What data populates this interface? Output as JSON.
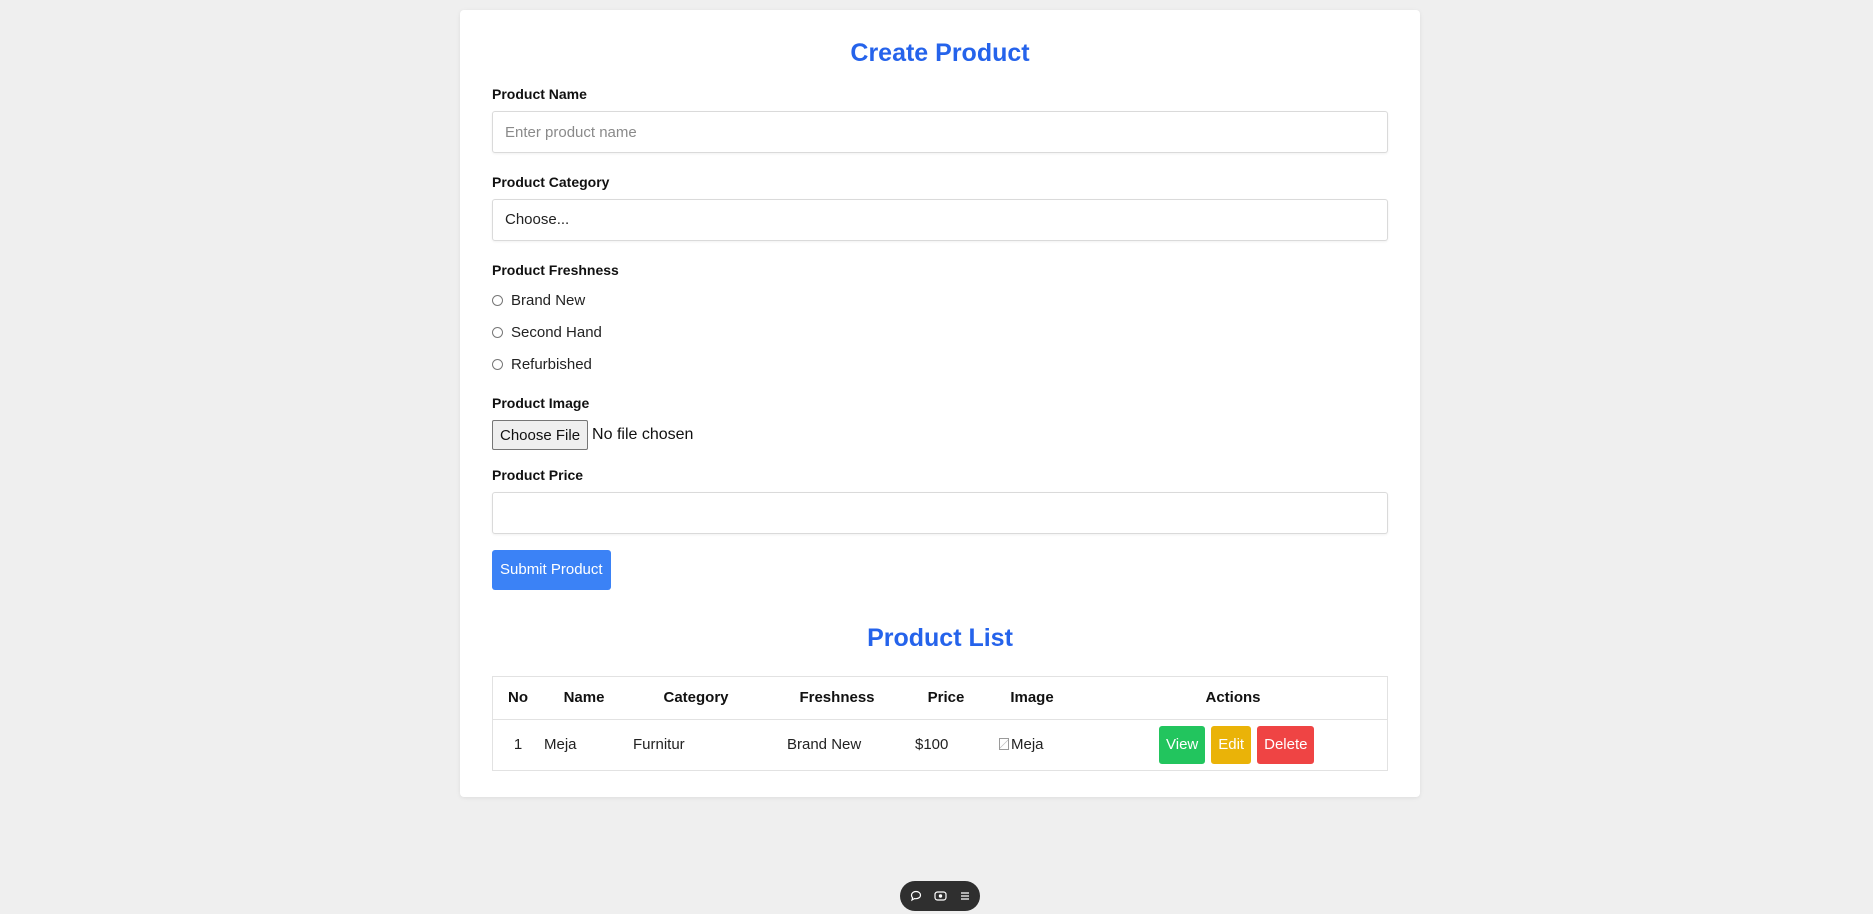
{
  "form": {
    "title": "Create Product",
    "name_label": "Product Name",
    "name_placeholder": "Enter product name",
    "name_value": "",
    "category_label": "Product Category",
    "category_selected": "Choose...",
    "freshness_label": "Product Freshness",
    "freshness_options": [
      "Brand New",
      "Second Hand",
      "Refurbished"
    ],
    "image_label": "Product Image",
    "file_button": "Choose File",
    "file_status": "No file chosen",
    "price_label": "Product Price",
    "price_value": "",
    "submit_label": "Submit Product"
  },
  "list": {
    "title": "Product List",
    "columns": [
      "No",
      "Name",
      "Category",
      "Freshness",
      "Price",
      "Image",
      "Actions"
    ],
    "rows": [
      {
        "no": "1",
        "name": "Meja",
        "category": "Furnitur",
        "freshness": "Brand New",
        "price": "$100",
        "image_alt": "Meja",
        "actions": [
          "View",
          "Edit",
          "Delete"
        ]
      }
    ]
  },
  "toolbar": {
    "icons": [
      "comment-icon",
      "eye-icon",
      "menu-icon"
    ]
  },
  "colors": {
    "accent": "#2563eb",
    "submit": "#3b82f6",
    "view": "#22c55e",
    "edit": "#eab308",
    "delete": "#ef4444",
    "background": "#efefef"
  }
}
